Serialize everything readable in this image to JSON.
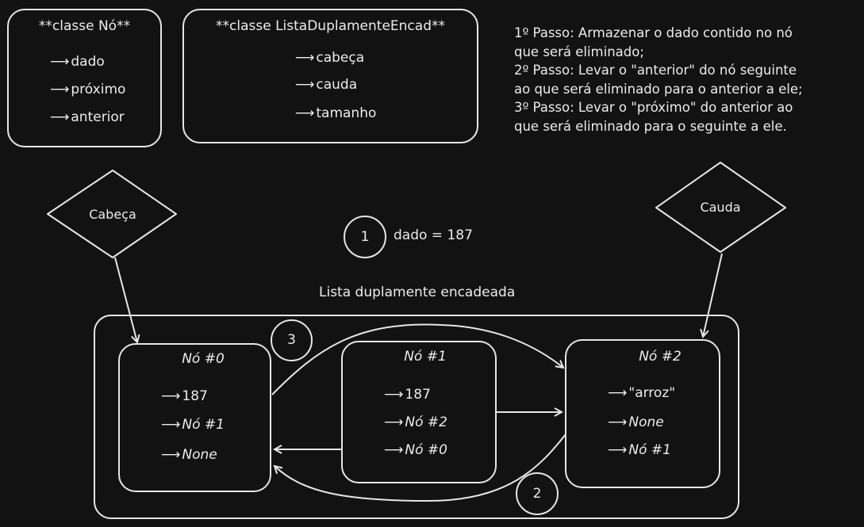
{
  "class_no": {
    "title": "**classe Nó**",
    "fields": [
      "dado",
      "próximo",
      "anterior"
    ]
  },
  "class_lista": {
    "title": "**classe ListaDuplamenteEncad**",
    "fields": [
      "cabeça",
      "cauda",
      "tamanho"
    ]
  },
  "steps": [
    "1º Passo: Armazenar o dado contido no nó",
    "que será eliminado;",
    "2º Passo: Levar o \"anterior\" do nó seguinte",
    "ao que será eliminado para o anterior a ele;",
    "3º Passo: Levar o \"próximo\" do anterior ao",
    "que será eliminado para o seguinte a ele."
  ],
  "head_label": "Cabeça",
  "tail_label": "Cauda",
  "step1": {
    "number": "1",
    "text": "dado = 187"
  },
  "step2_number": "2",
  "step3_number": "3",
  "list_title": "Lista duplamente encadeada",
  "nodes": [
    {
      "title": "Nó #0",
      "dado": "187",
      "proximo": "Nó #1",
      "anterior": "None"
    },
    {
      "title": "Nó #1",
      "dado": "187",
      "proximo": "Nó #2",
      "anterior": "Nó #0"
    },
    {
      "title": "Nó #2",
      "dado": "\"arroz\"",
      "proximo": "None",
      "anterior": "Nó #1"
    }
  ]
}
